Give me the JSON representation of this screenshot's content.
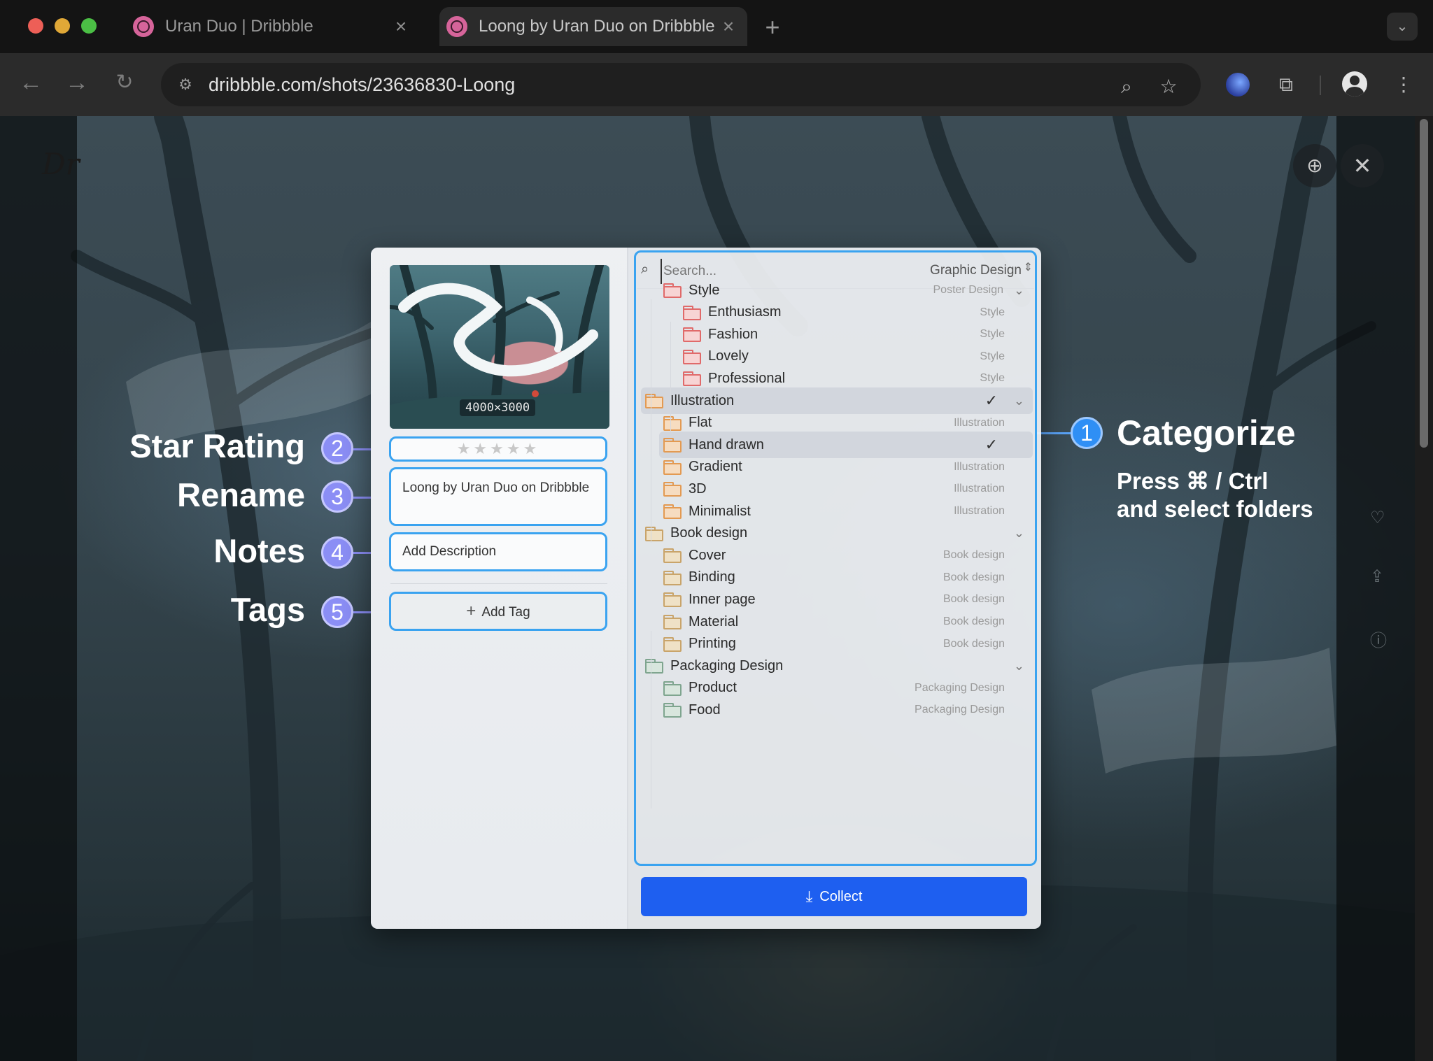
{
  "browser": {
    "tabs": [
      {
        "title": "Uran Duo | Dribbble",
        "active": false
      },
      {
        "title": "Loong by Uran Duo on Dribbble",
        "active": true
      }
    ],
    "new_tab_label": "+",
    "url": "dribbble.com/shots/23636830-Loong"
  },
  "page": {
    "logo_text": "Dr"
  },
  "annotations": {
    "star_rating": {
      "label": "Star Rating",
      "num": "2"
    },
    "rename": {
      "label": "Rename",
      "num": "3"
    },
    "notes": {
      "label": "Notes",
      "num": "4"
    },
    "tags": {
      "label": "Tags",
      "num": "5"
    },
    "categorize": {
      "label": "Categorize",
      "num": "1",
      "sub_line1": "Press ⌘ / Ctrl",
      "sub_line2": "and select folders"
    }
  },
  "panel": {
    "thumbnail_dims": "4000×3000",
    "rating_stars": "★★★★★",
    "rating_value": 0,
    "rating_max": 5,
    "title_value": "Loong by Uran Duo on Dribbble",
    "description_placeholder": "Add Description",
    "add_tag_label": "Add Tag",
    "search_placeholder": "Search...",
    "search_scope": "Graphic Design",
    "collect_label": "Collect",
    "colors": {
      "field_border": "#3aa3f0",
      "collect_button": "#1e5ff0",
      "folder_red": "#e06a6a",
      "folder_orange": "#e39a52",
      "folder_tan": "#c9a46a",
      "folder_green": "#7fa58f"
    },
    "folders": [
      {
        "name": "Style",
        "category": "Poster Design",
        "level": 1,
        "color": "red",
        "chevron": true
      },
      {
        "name": "Enthusiasm",
        "category": "Style",
        "level": 2,
        "color": "red"
      },
      {
        "name": "Fashion",
        "category": "Style",
        "level": 2,
        "color": "red"
      },
      {
        "name": "Lovely",
        "category": "Style",
        "level": 2,
        "color": "red"
      },
      {
        "name": "Professional",
        "category": "Style",
        "level": 2,
        "color": "red"
      },
      {
        "name": "Illustration",
        "category": "",
        "level": 0,
        "color": "orange",
        "checked": true,
        "selected": true,
        "chevron": true
      },
      {
        "name": "Flat",
        "category": "Illustration",
        "level": 1,
        "color": "orange"
      },
      {
        "name": "Hand drawn",
        "category": "",
        "level": 1,
        "color": "orange",
        "checked": true,
        "selected": true
      },
      {
        "name": "Gradient",
        "category": "Illustration",
        "level": 1,
        "color": "orange"
      },
      {
        "name": "3D",
        "category": "Illustration",
        "level": 1,
        "color": "orange"
      },
      {
        "name": "Minimalist",
        "category": "Illustration",
        "level": 1,
        "color": "orange"
      },
      {
        "name": "Book design",
        "category": "",
        "level": 0,
        "color": "tan",
        "chevron": true
      },
      {
        "name": "Cover",
        "category": "Book design",
        "level": 1,
        "color": "tan"
      },
      {
        "name": "Binding",
        "category": "Book design",
        "level": 1,
        "color": "tan"
      },
      {
        "name": "Inner page",
        "category": "Book design",
        "level": 1,
        "color": "tan"
      },
      {
        "name": "Material",
        "category": "Book design",
        "level": 1,
        "color": "tan"
      },
      {
        "name": "Printing",
        "category": "Book design",
        "level": 1,
        "color": "tan"
      },
      {
        "name": "Packaging Design",
        "category": "",
        "level": 0,
        "color": "green",
        "chevron": true
      },
      {
        "name": "Product",
        "category": "Packaging Design",
        "level": 1,
        "color": "green"
      },
      {
        "name": "Food",
        "category": "Packaging Design",
        "level": 1,
        "color": "green"
      }
    ]
  }
}
